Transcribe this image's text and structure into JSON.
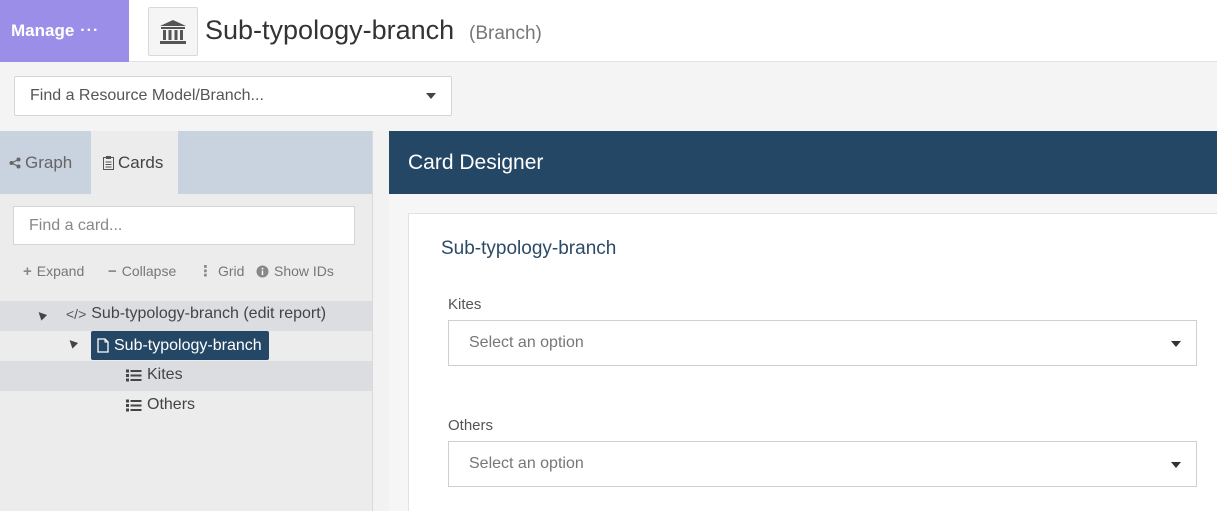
{
  "header": {
    "manage_label": "Manage",
    "manage_dots": "···",
    "title": "Sub-typology-branch",
    "subtitle": "(Branch)",
    "icon": "bank-icon"
  },
  "resource_search": {
    "placeholder": "Find a Resource Model/Branch..."
  },
  "left_panel": {
    "tabs": [
      {
        "label": "Graph",
        "icon": "share-icon"
      },
      {
        "label": "Cards",
        "icon": "clipboard-icon"
      }
    ],
    "card_search_placeholder": "Find a card...",
    "tools": {
      "expand": "Expand",
      "collapse": "Collapse",
      "grid": "Grid",
      "show_ids": "Show IDs"
    },
    "tree": [
      {
        "label": "Sub-typology-branch (edit report)",
        "icon": "code-icon"
      },
      {
        "label": "Sub-typology-branch",
        "icon": "file-icon"
      },
      {
        "label": "Kites",
        "icon": "list-icon"
      },
      {
        "label": "Others",
        "icon": "list-icon"
      }
    ]
  },
  "designer": {
    "header": "Card Designer",
    "card_title": "Sub-typology-branch",
    "fields": [
      {
        "label": "Kites",
        "placeholder": "Select an option"
      },
      {
        "label": "Others",
        "placeholder": "Select an option"
      }
    ]
  },
  "colors": {
    "manage_bg": "#9a8ee8",
    "navy": "#254766",
    "tab_strip": "#c8d3df"
  }
}
